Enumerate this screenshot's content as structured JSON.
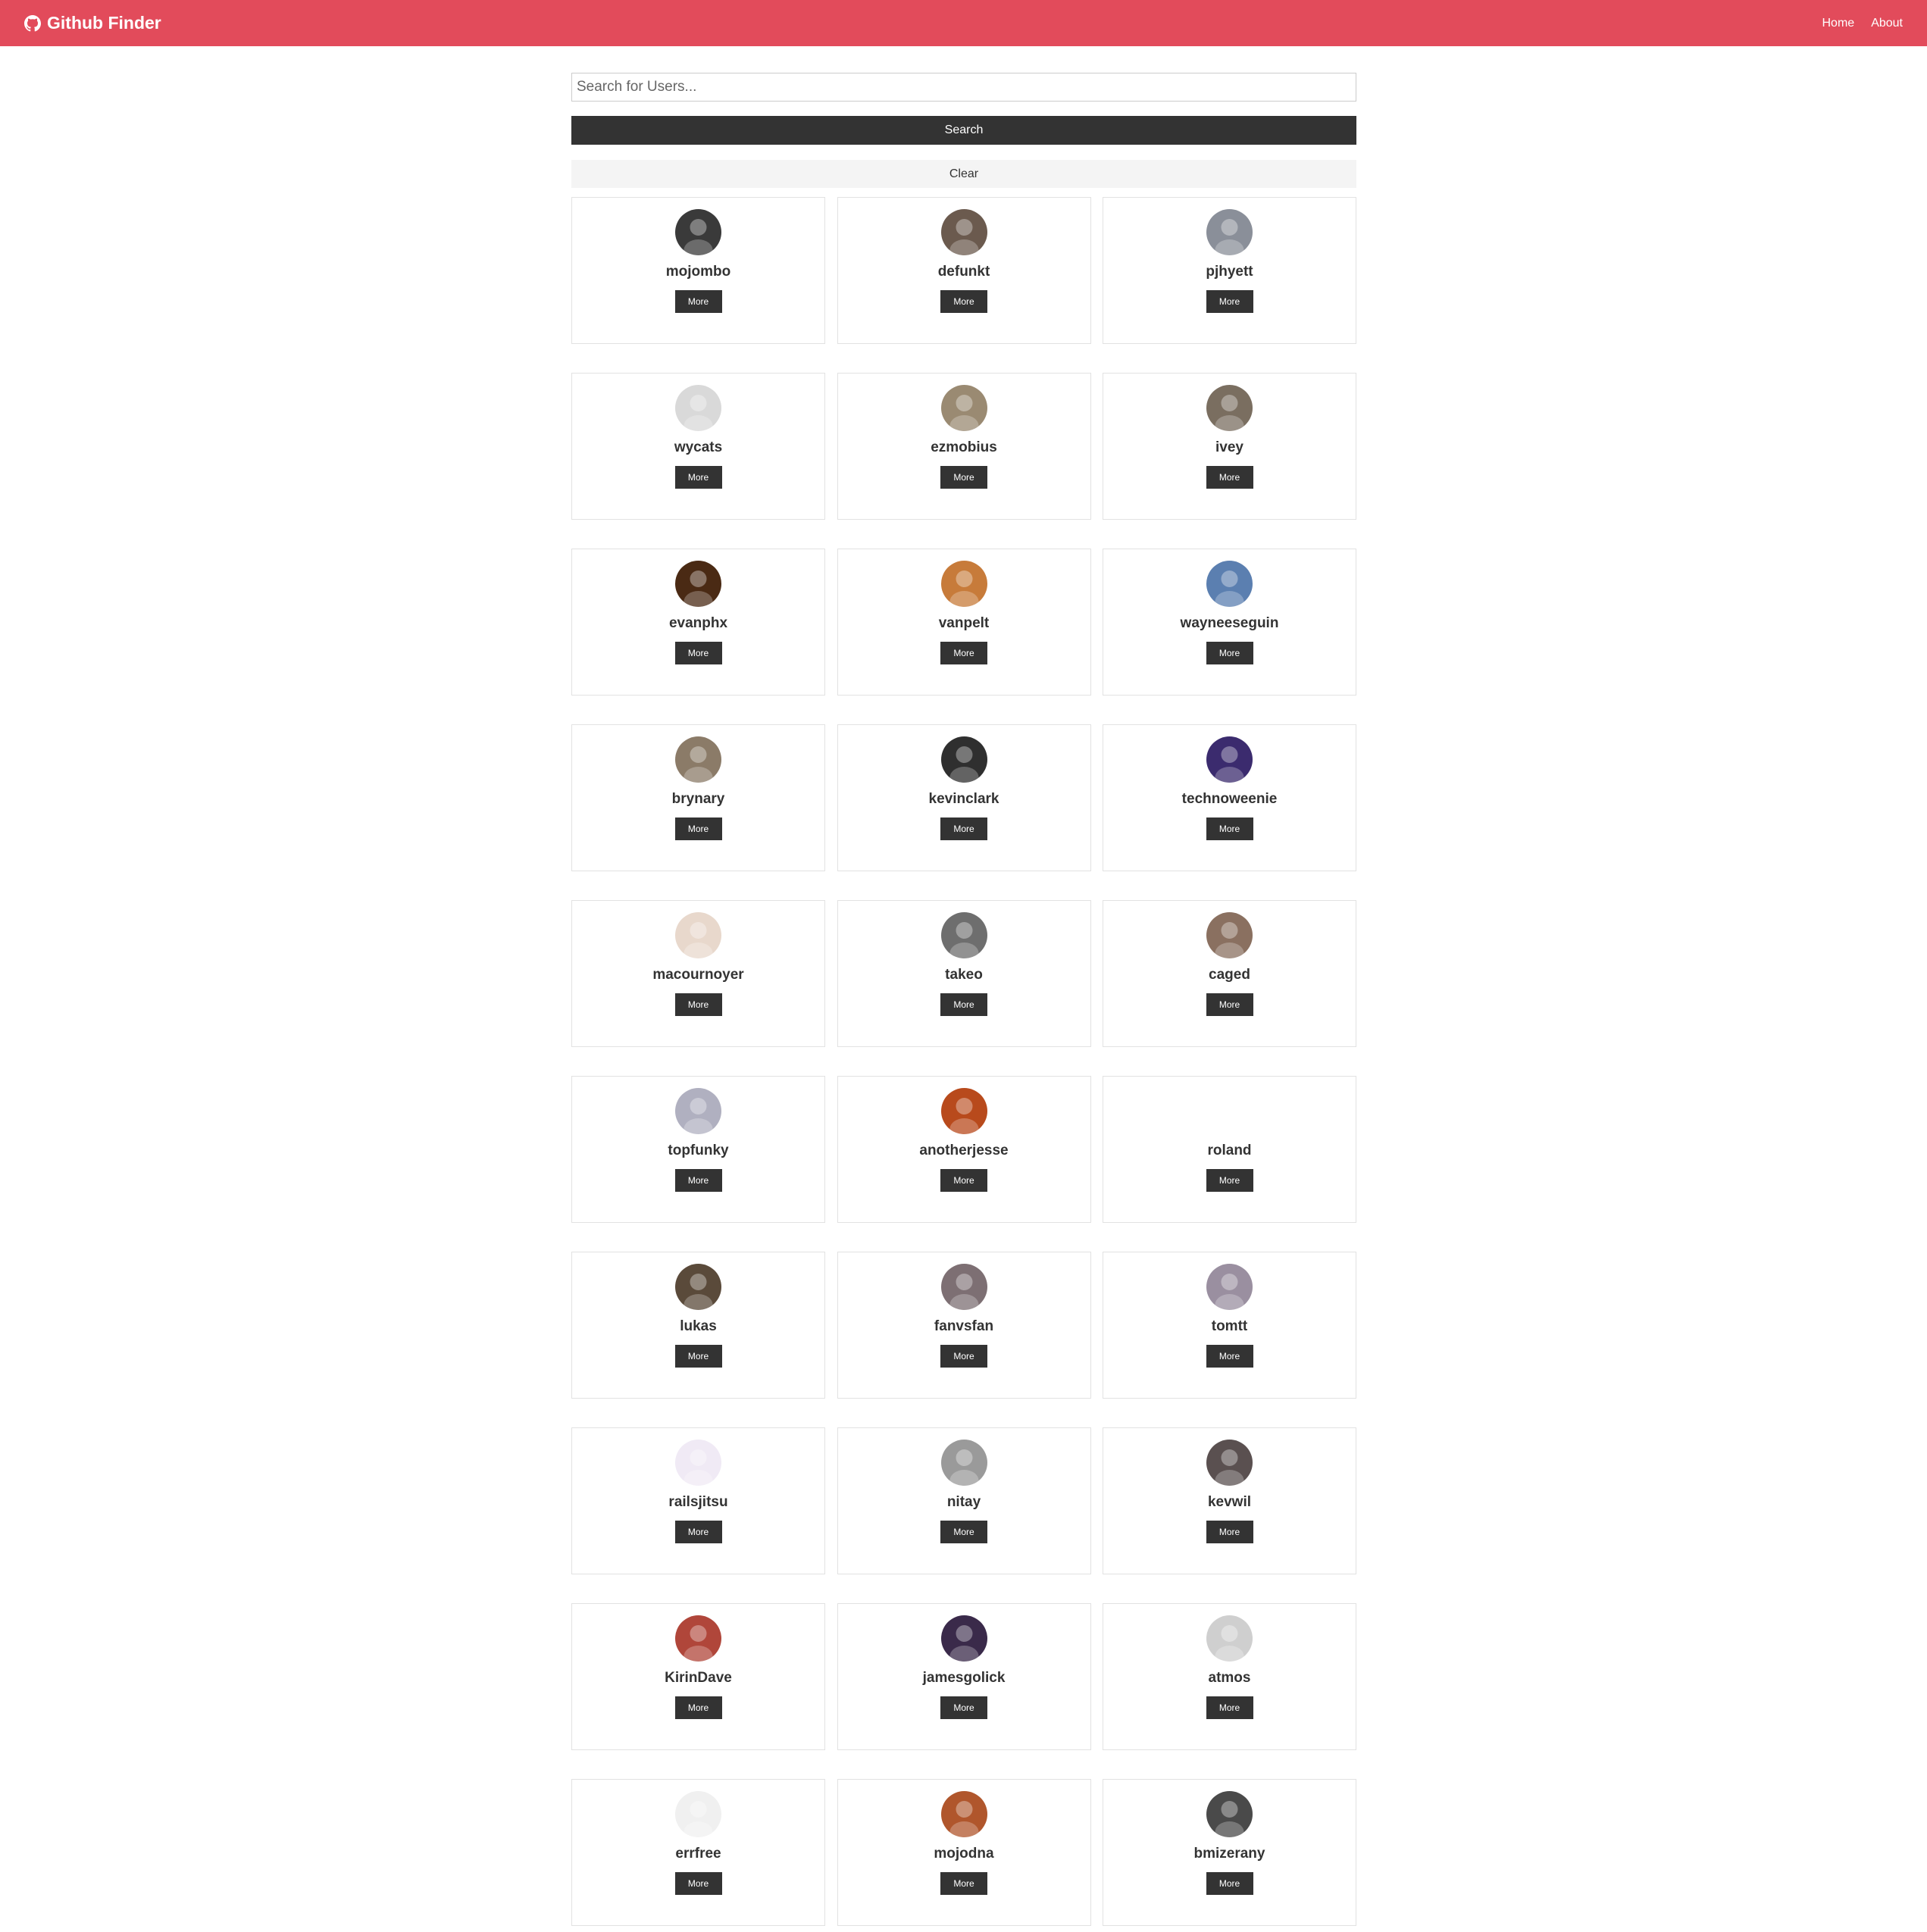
{
  "navbar": {
    "brand_icon": "github-icon",
    "brand": "Github Finder",
    "links": [
      "Home",
      "About"
    ]
  },
  "search": {
    "placeholder": "Search for Users...",
    "value": "",
    "submit_label": "Search",
    "clear_label": "Clear"
  },
  "colors": {
    "navbar": "#e24b5b",
    "dark_button": "#333333",
    "light_button": "#f4f4f4"
  },
  "users": [
    {
      "login": "mojombo",
      "button": "More",
      "avatar_color": "#3a3a3a"
    },
    {
      "login": "defunkt",
      "button": "More",
      "avatar_color": "#6b5a4e"
    },
    {
      "login": "pjhyett",
      "button": "More",
      "avatar_color": "#8a8f99"
    },
    {
      "login": "wycats",
      "button": "More",
      "avatar_color": "#d9d9d9"
    },
    {
      "login": "ezmobius",
      "button": "More",
      "avatar_color": "#9a8a72"
    },
    {
      "login": "ivey",
      "button": "More",
      "avatar_color": "#7a6e60"
    },
    {
      "login": "evanphx",
      "button": "More",
      "avatar_color": "#4a2a14"
    },
    {
      "login": "vanpelt",
      "button": "More",
      "avatar_color": "#c77b3a"
    },
    {
      "login": "wayneeseguin",
      "button": "More",
      "avatar_color": "#5b7fb0"
    },
    {
      "login": "brynary",
      "button": "More",
      "avatar_color": "#8b7b68"
    },
    {
      "login": "kevinclark",
      "button": "More",
      "avatar_color": "#2f2f2f"
    },
    {
      "login": "technoweenie",
      "button": "More",
      "avatar_color": "#3b2b6e"
    },
    {
      "login": "macournoyer",
      "button": "More",
      "avatar_color": "#e8d8cc"
    },
    {
      "login": "takeo",
      "button": "More",
      "avatar_color": "#6e6e6e"
    },
    {
      "login": "caged",
      "button": "More",
      "avatar_color": "#8a7060"
    },
    {
      "login": "topfunky",
      "button": "More",
      "avatar_color": "#b0b0c0"
    },
    {
      "login": "anotherjesse",
      "button": "More",
      "avatar_color": "#b84a1c"
    },
    {
      "login": "roland",
      "button": "More",
      "avatar_color": "#ffffff"
    },
    {
      "login": "lukas",
      "button": "More",
      "avatar_color": "#5a4a3a"
    },
    {
      "login": "fanvsfan",
      "button": "More",
      "avatar_color": "#7d6f73"
    },
    {
      "login": "tomtt",
      "button": "More",
      "avatar_color": "#9a8fa0"
    },
    {
      "login": "railsjitsu",
      "button": "More",
      "avatar_color": "#f0eaf5"
    },
    {
      "login": "nitay",
      "button": "More",
      "avatar_color": "#9a9a9a"
    },
    {
      "login": "kevwil",
      "button": "More",
      "avatar_color": "#5a5050"
    },
    {
      "login": "KirinDave",
      "button": "More",
      "avatar_color": "#b0463a"
    },
    {
      "login": "jamesgolick",
      "button": "More",
      "avatar_color": "#3a2a4a"
    },
    {
      "login": "atmos",
      "button": "More",
      "avatar_color": "#cfcfcf"
    },
    {
      "login": "errfree",
      "button": "More",
      "avatar_color": "#f0f0f0"
    },
    {
      "login": "mojodna",
      "button": "More",
      "avatar_color": "#b0562c"
    },
    {
      "login": "bmizerany",
      "button": "More",
      "avatar_color": "#4a4a4a"
    }
  ]
}
